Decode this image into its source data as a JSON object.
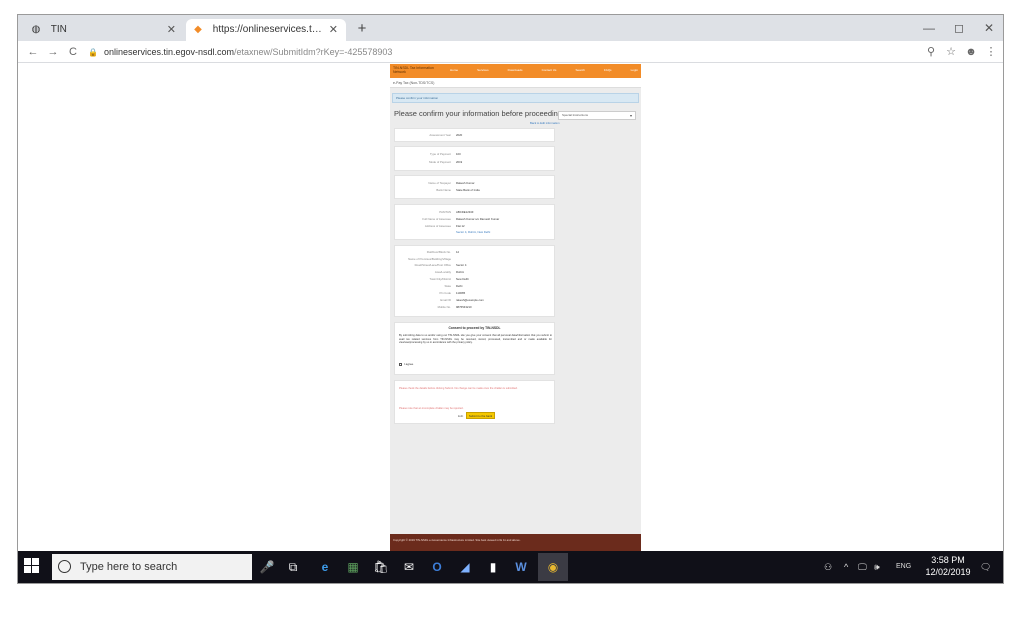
{
  "browser": {
    "tabs": [
      {
        "label": "TIN",
        "icon": "globe-icon"
      },
      {
        "label": "https://onlineservices.tin.egov-n",
        "icon": "nsdl-favicon"
      }
    ],
    "new_tab": "+",
    "window_controls": {
      "minimize": "—",
      "maximize": "◻",
      "close": "✕"
    },
    "nav": {
      "back": "←",
      "forward": "→",
      "reload": "C"
    },
    "address": {
      "host": "onlineservices.tin.egov-nsdl.com",
      "path": "/etaxnew/SubmitIdm?rKey=-425578903"
    },
    "toolbar_icons": {
      "zoom": "⚲",
      "star": "☆",
      "account": "☻",
      "menu": "⋮"
    }
  },
  "page": {
    "header": {
      "logo": "TIN-NSDL Tax Information Network",
      "nav": [
        "Home",
        "Services",
        "Downloads",
        "Contact Us",
        "Search",
        "FAQs",
        "Login"
      ]
    },
    "breadcrumb": "e-Pay Tax (Non-TDS/TCS)",
    "note": "Please confirm your information",
    "heading": "Please confirm your information before proceeding",
    "subnote": "Back to Edit information",
    "side_select": {
      "label": "Special Instructions",
      "arrow": "▾"
    },
    "card1": [
      {
        "label": "Assessment Year",
        "value": "2020"
      }
    ],
    "card2": [
      {
        "label": "Type of Payment",
        "value": "100"
      },
      {
        "label": "Mode of Payment",
        "value": "2019"
      }
    ],
    "card3": [
      {
        "label": "Name of Taxpayer",
        "value": "Rakesh Kumar"
      },
      {
        "label": "Bank Name",
        "value": "State Bank of India"
      }
    ],
    "card4": [
      {
        "label": "PAN/TAN",
        "value": "ABCDE1234F"
      },
      {
        "label": "Full Name of Assessee",
        "value": "Rakesh Kumar s/o Ramesh Kumar"
      },
      {
        "label": "Address of Assessee",
        "value": "Flat 12"
      },
      {
        "label": "",
        "value": "Sector 4, Rohini, New Delhi"
      }
    ],
    "card5": [
      {
        "label": "Flat/Door/Block No.",
        "value": "12"
      },
      {
        "label": "Name of Premises/Building/Village",
        "value": ""
      },
      {
        "label": "Road/Street/Lane/Post Office",
        "value": "Sector 4"
      },
      {
        "label": "Area/Locality",
        "value": "Rohini"
      },
      {
        "label": "Town/City/District",
        "value": "New Delhi"
      },
      {
        "label": "State",
        "value": "Delhi"
      },
      {
        "label": "Pin Code",
        "value": "110085"
      },
      {
        "label": "Email ID",
        "value": "rakesh@example.com"
      },
      {
        "label": "Mobile No.",
        "value": "9876543210"
      }
    ],
    "consent": {
      "title": "Consent to proceed by TIN-NSDL",
      "text": "By submitting data to us and/or using our TIN-NSDL site you give your consent that all personal data/information that you submit to avail tax related services from TIN-NSDL may be received, stored, processed, transmitted and or made available for view/use/processing by us in accordance with the privacy policy.",
      "agree": "I agree"
    },
    "warning": {
      "text": "Please check the details before clicking Submit. No change can be made once the challan is submitted.",
      "note": "Please note that an incomplete challan may be rejected.",
      "back": "Edit",
      "submit": "Submit to the bank"
    },
    "footer": "Copyright © 2019 TIN-NSDL e-Governance Infrastructure Limited. Site best viewed in IE 11 and above."
  },
  "taskbar": {
    "search_placeholder": "Type here to search",
    "apps": [
      "🎤",
      "⧉",
      "e",
      "▦",
      "🛍",
      "✉",
      "O",
      "◢",
      "▮",
      "W",
      "◉"
    ],
    "tray": {
      "people": "⚇",
      "chevron": "^",
      "network": "🖵",
      "sound": "🕪",
      "lang": "ENG",
      "notification": "🗨"
    },
    "time": "3:58 PM",
    "date": "12/02/2019"
  }
}
